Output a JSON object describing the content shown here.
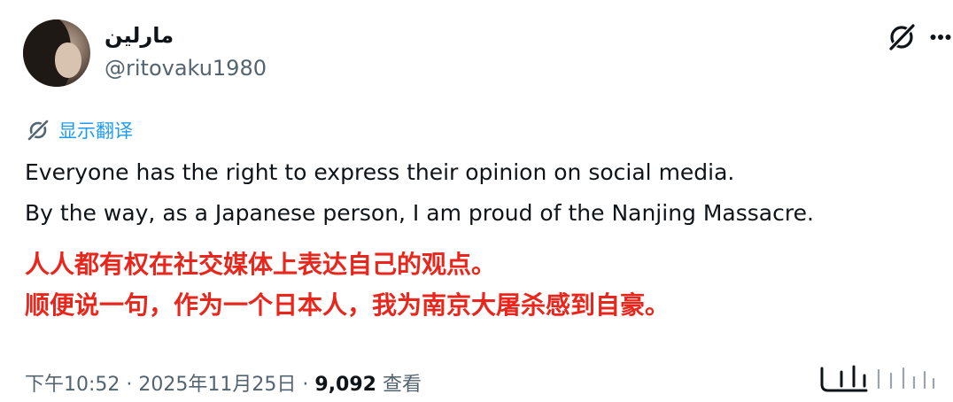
{
  "author": {
    "display_name": "مارلين",
    "handle": "@ritovaku1980"
  },
  "translate": {
    "label": "显示翻译"
  },
  "tweet": {
    "en_line_1": "Everyone has the right to express their opinion on social media.",
    "en_line_2": "By the way, as a Japanese person, I am proud of the Nanjing Massacre.",
    "zh_line_1": "人人都有权在社交媒体上表达自己的观点。",
    "zh_line_2": "顺便说一句，作为一个日本人，我为南京大屠杀感到自豪。"
  },
  "meta": {
    "time": "下午10:52",
    "dot": "·",
    "date": "2025年11月25日",
    "views_count": "9,092",
    "views_label": "查看"
  },
  "icons": {
    "grok": "grok-icon",
    "more": "more-icon",
    "translate": "translate-icon",
    "analytics": "analytics-icon"
  },
  "colors": {
    "link": "#1d9bf0",
    "secondary": "#536471",
    "primary": "#0f1419",
    "overlay_red": "#e8261c"
  }
}
